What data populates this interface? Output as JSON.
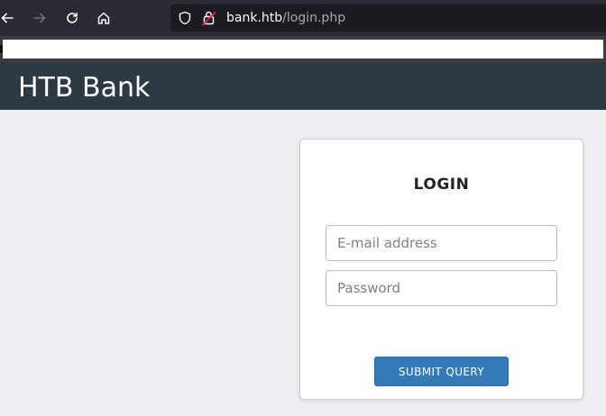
{
  "browser": {
    "back_icon": "arrow-left-icon",
    "forward_icon": "arrow-right-icon",
    "reload_icon": "reload-icon",
    "home_icon": "home-icon",
    "shield_icon": "shield-icon",
    "lock_icon": "lock-warning-icon",
    "url_host": "bank.htb",
    "url_path": "/login.php"
  },
  "site": {
    "title": "HTB Bank"
  },
  "login": {
    "heading": "LOGIN",
    "email_placeholder": "E-mail address",
    "password_placeholder": "Password",
    "submit_label": "SUBMIT QUERY"
  },
  "colors": {
    "header_bg": "#2d3a44",
    "button_bg": "#337ab7",
    "page_bg": "#eeeff3"
  }
}
